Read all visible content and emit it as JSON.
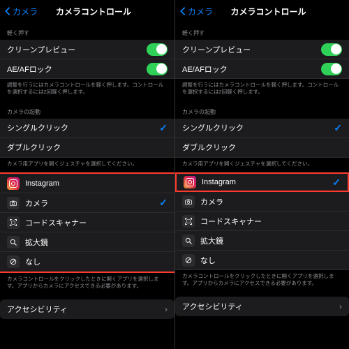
{
  "header": {
    "back": "カメラ",
    "title": "カメラコントロール"
  },
  "sections": {
    "light_press": "軽く押す",
    "light_press_footer": "調整を行うにはカメラコントロールを軽く押します。コントロールを選択するには2回軽く押します。",
    "launch": "カメラの起動",
    "launch_footer": "カメラ用アプリを開くジェスチャを選択してください。",
    "apps_footer": "カメラコントロールをクリックしたときに開くアプリを選択します。アプリからカメラにアクセスできる必要があります。"
  },
  "rows": {
    "clean_preview": "クリーンプレビュー",
    "ae_af_lock": "AE/AFロック",
    "single_click": "シングルクリック",
    "double_click": "ダブルクリック",
    "instagram": "Instagram",
    "camera": "カメラ",
    "code_scanner": "コードスキャナー",
    "magnifier": "拡大鏡",
    "none": "なし",
    "accessibility": "アクセシビリティ"
  },
  "selection": {
    "left_app": "camera",
    "right_app": "instagram"
  }
}
